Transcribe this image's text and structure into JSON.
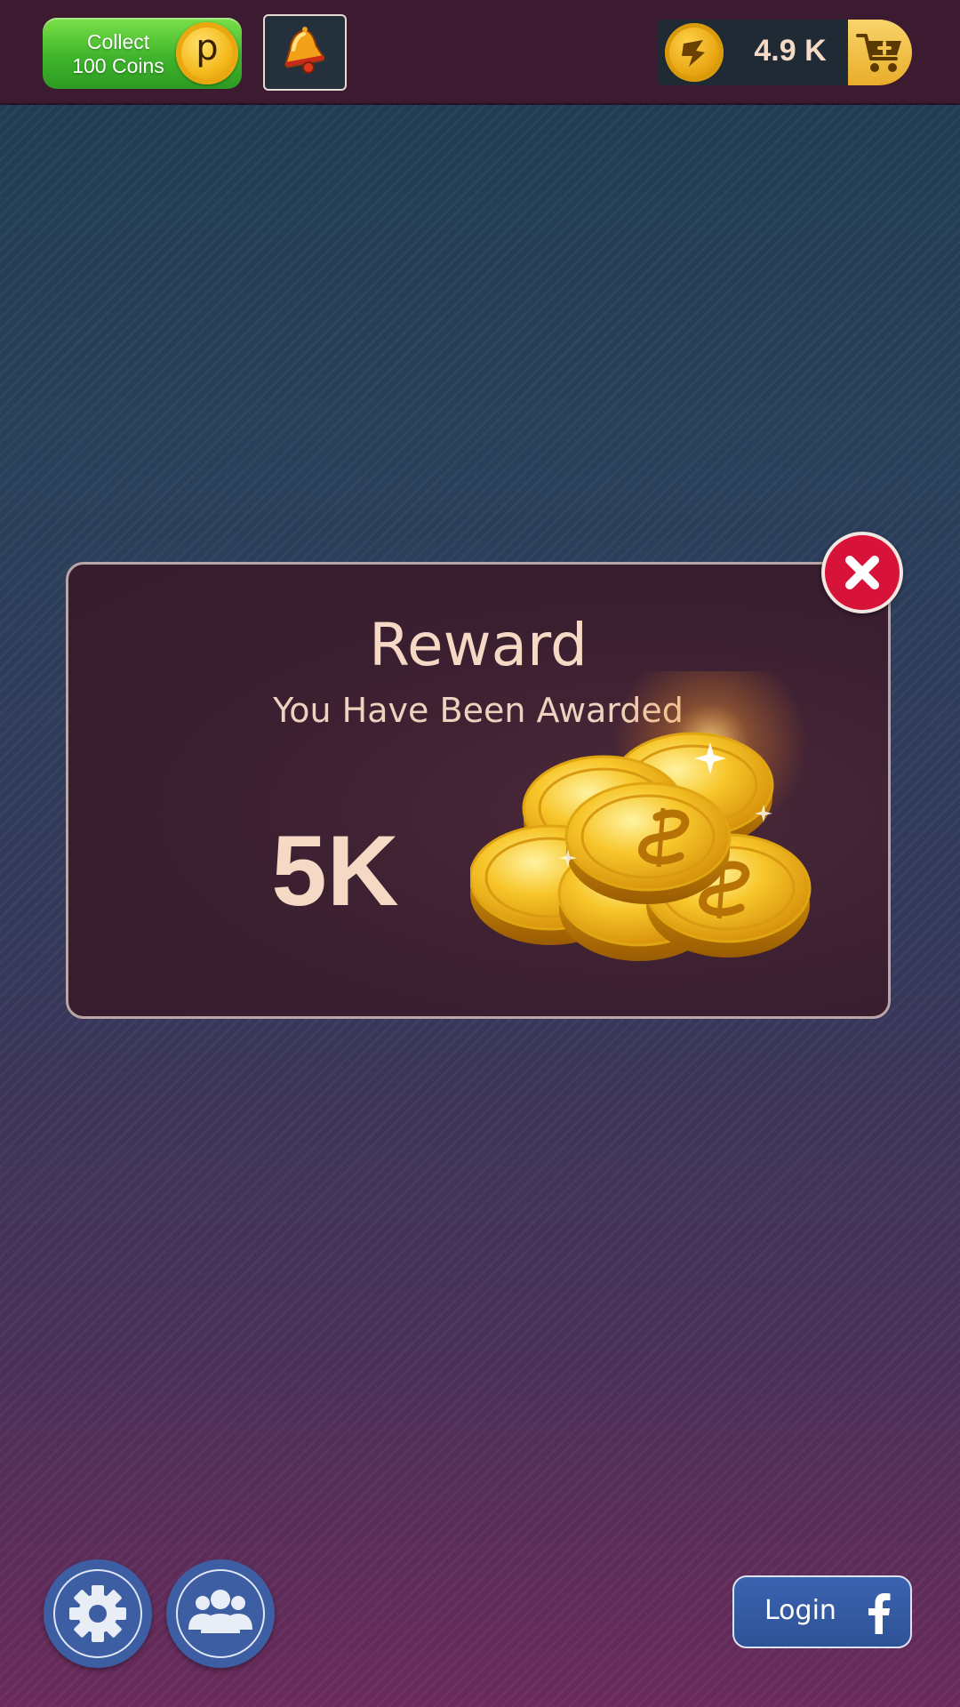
{
  "header": {
    "collect_line1": "Collect",
    "collect_line2": "100 Coins",
    "collect_coin_letter": "p",
    "balance": "4.9 K"
  },
  "reward": {
    "title": "Reward",
    "subtitle": "You Have Been Awarded",
    "amount": "5K"
  },
  "footer": {
    "login_label": "Login"
  },
  "icons": [
    "p-coin-icon",
    "bell-icon",
    "coin-icon",
    "cart-plus-icon",
    "coin-pile-icon",
    "close-icon",
    "gear-icon",
    "users-icon",
    "facebook-icon"
  ],
  "colors": {
    "collect_green": "#3fb52c",
    "close_red": "#d8133a",
    "gold": "#f3b71a",
    "accent_blue": "#3e5ea4",
    "text_peach": "#f5d9c4",
    "topbar": "#3c1a30"
  }
}
